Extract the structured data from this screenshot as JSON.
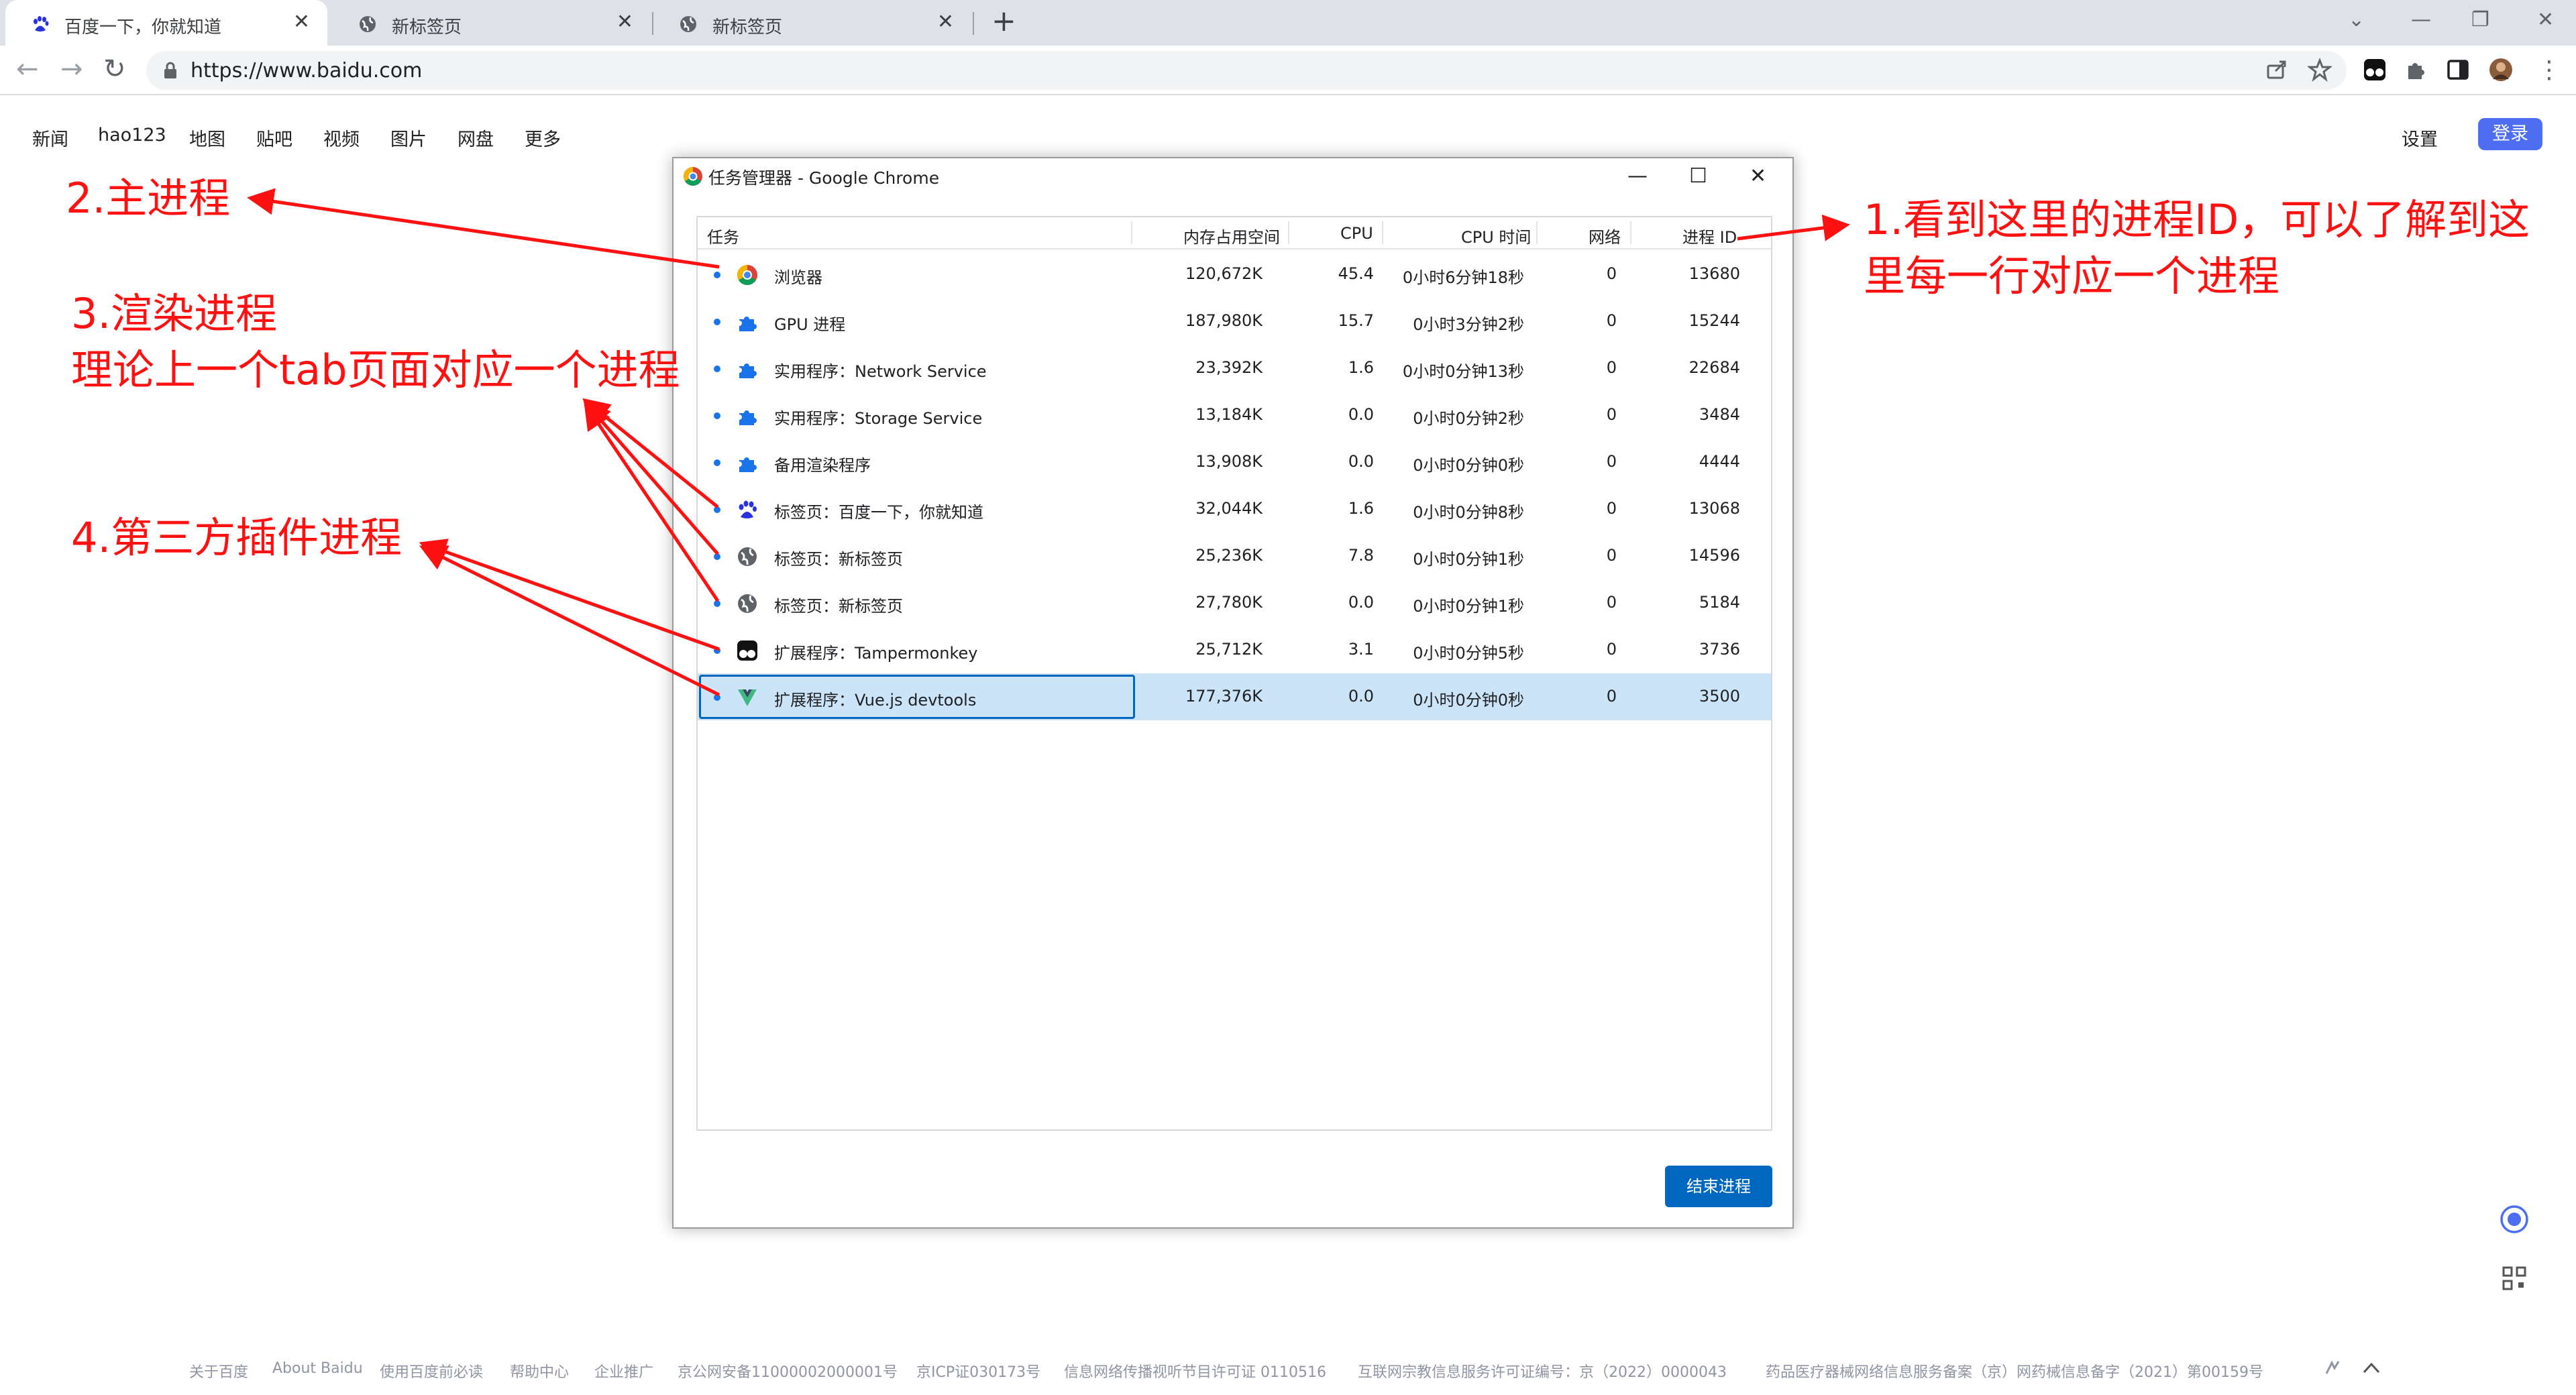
{
  "browser": {
    "tabs": [
      {
        "title": "百度一下，你就知道",
        "icon": "baidu-paw-icon",
        "active": true
      },
      {
        "title": "新标签页",
        "icon": "globe-icon",
        "active": false
      },
      {
        "title": "新标签页",
        "icon": "globe-icon",
        "active": false
      }
    ],
    "url": "https://www.baidu.com"
  },
  "baidu": {
    "nav": [
      "新闻",
      "hao123",
      "地图",
      "贴吧",
      "视频",
      "图片",
      "网盘",
      "更多"
    ],
    "settings": "设置",
    "login": "登录",
    "footer": [
      "关于百度",
      "About Baidu",
      "使用百度前必读",
      "帮助中心",
      "企业推广",
      "京公网安备11000002000001号",
      "京ICP证030173号",
      "信息网络传播视听节目许可证 0110516",
      "互联网宗教信息服务许可证编号：京（2022）0000043",
      "药品医疗器械网络信息服务备案（京）网药械信息备字（2021）第00159号"
    ]
  },
  "task_manager": {
    "title": "任务管理器 - Google Chrome",
    "columns": [
      "任务",
      "内存占用空间",
      "CPU",
      "CPU 时间",
      "网络",
      "进程 ID"
    ],
    "rows": [
      {
        "task": "浏览器",
        "icon": "chrome-icon",
        "memory": "120,672K",
        "cpu": "45.4",
        "cpu_time": "0小时6分钟18秒",
        "network": "0",
        "pid": "13680",
        "selected": false
      },
      {
        "task": "GPU 进程",
        "icon": "puzzle-icon",
        "memory": "187,980K",
        "cpu": "15.7",
        "cpu_time": "0小时3分钟2秒",
        "network": "0",
        "pid": "15244",
        "selected": false
      },
      {
        "task": "实用程序：Network Service",
        "icon": "puzzle-icon",
        "memory": "23,392K",
        "cpu": "1.6",
        "cpu_time": "0小时0分钟13秒",
        "network": "0",
        "pid": "22684",
        "selected": false
      },
      {
        "task": "实用程序：Storage Service",
        "icon": "puzzle-icon",
        "memory": "13,184K",
        "cpu": "0.0",
        "cpu_time": "0小时0分钟2秒",
        "network": "0",
        "pid": "3484",
        "selected": false
      },
      {
        "task": "备用渲染程序",
        "icon": "puzzle-icon",
        "memory": "13,908K",
        "cpu": "0.0",
        "cpu_time": "0小时0分钟0秒",
        "network": "0",
        "pid": "4444",
        "selected": false
      },
      {
        "task": "标签页：百度一下，你就知道",
        "icon": "baidu-paw-icon",
        "memory": "32,044K",
        "cpu": "1.6",
        "cpu_time": "0小时0分钟8秒",
        "network": "0",
        "pid": "13068",
        "selected": false
      },
      {
        "task": "标签页：新标签页",
        "icon": "globe-icon",
        "memory": "25,236K",
        "cpu": "7.8",
        "cpu_time": "0小时0分钟1秒",
        "network": "0",
        "pid": "14596",
        "selected": false
      },
      {
        "task": "标签页：新标签页",
        "icon": "globe-icon",
        "memory": "27,780K",
        "cpu": "0.0",
        "cpu_time": "0小时0分钟1秒",
        "network": "0",
        "pid": "5184",
        "selected": false
      },
      {
        "task": "扩展程序：Tampermonkey",
        "icon": "tampermonkey-icon",
        "memory": "25,712K",
        "cpu": "3.1",
        "cpu_time": "0小时0分钟5秒",
        "network": "0",
        "pid": "3736",
        "selected": false
      },
      {
        "task": "扩展程序：Vue.js devtools",
        "icon": "vue-icon",
        "memory": "177,376K",
        "cpu": "0.0",
        "cpu_time": "0小时0分钟0秒",
        "network": "0",
        "pid": "3500",
        "selected": true
      }
    ],
    "end_process": "结束进程"
  },
  "annotations": {
    "a1_line1": "1.看到这里的进程ID，可以了解到这",
    "a1_line2": "里每一行对应一个进程",
    "a2": "2.主进程",
    "a3_line1": "3.渲染进程",
    "a3_line2": "理论上一个tab页面对应一个进程",
    "a4": "4.第三方插件进程",
    "color": "#ff1111"
  }
}
